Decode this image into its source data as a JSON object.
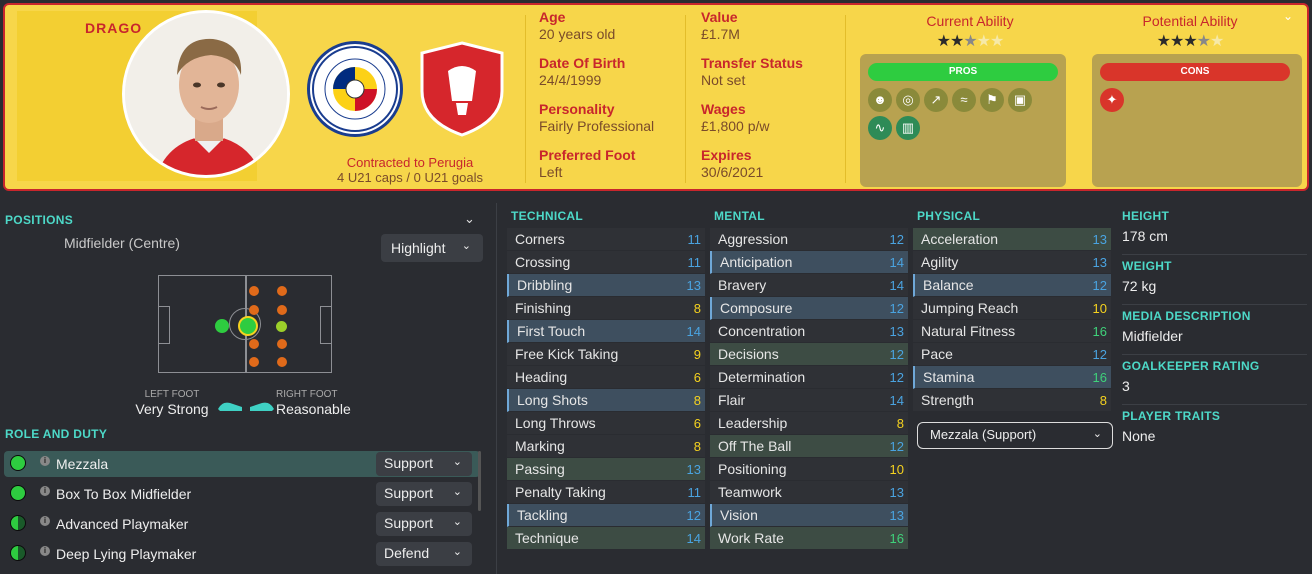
{
  "header": {
    "name": "DRAGO",
    "contract_line": "Contracted to Perugia",
    "caps_line": "4 U21 caps / 0 U21 goals",
    "info_left": [
      {
        "label": "Age",
        "value": "20 years old"
      },
      {
        "label": "Date Of Birth",
        "value": "24/4/1999"
      },
      {
        "label": "Personality",
        "value": "Fairly Professional"
      },
      {
        "label": "Preferred Foot",
        "value": "Left"
      }
    ],
    "info_right": [
      {
        "label": "Value",
        "value": "£1.7M"
      },
      {
        "label": "Transfer Status",
        "value": "Not set"
      },
      {
        "label": "Wages",
        "value": "£1,800 p/w"
      },
      {
        "label": "Expires",
        "value": "30/6/2021"
      }
    ],
    "current_ability": {
      "label": "Current Ability",
      "stars": 2.5
    },
    "potential_ability": {
      "label": "Potential Ability",
      "stars": 3.5
    },
    "pros_label": "PROS",
    "cons_label": "CONS",
    "pros_icons": [
      "brain-icon",
      "target-icon",
      "boot-icon",
      "wings-icon",
      "flag-icon",
      "field-icon",
      "pulse-icon",
      "locker-icon"
    ],
    "cons_icons": [
      "footprint-icon"
    ],
    "colors": {
      "accent": "#c8262c",
      "header_bg": "#f7d64a",
      "pros": "#2ecc40",
      "cons": "#d9352a"
    }
  },
  "positions": {
    "title": "POSITIONS",
    "primary": "Midfielder (Centre)",
    "highlight_label": "Highlight",
    "left_foot_label": "LEFT FOOT",
    "left_foot_value": "Very Strong",
    "right_foot_label": "RIGHT FOOT",
    "right_foot_value": "Reasonable"
  },
  "role_duty": {
    "title": "ROLE AND DUTY",
    "roles": [
      {
        "name": "Mezzala",
        "duty": "Support"
      },
      {
        "name": "Box To Box Midfielder",
        "duty": "Support"
      },
      {
        "name": "Advanced Playmaker",
        "duty": "Support"
      },
      {
        "name": "Deep Lying Playmaker",
        "duty": "Defend"
      }
    ]
  },
  "technical": {
    "title": "TECHNICAL",
    "attrs": [
      {
        "name": "Corners",
        "value": "11"
      },
      {
        "name": "Crossing",
        "value": "11"
      },
      {
        "name": "Dribbling",
        "value": "13"
      },
      {
        "name": "Finishing",
        "value": "8"
      },
      {
        "name": "First Touch",
        "value": "14"
      },
      {
        "name": "Free Kick Taking",
        "value": "9"
      },
      {
        "name": "Heading",
        "value": "6"
      },
      {
        "name": "Long Shots",
        "value": "8"
      },
      {
        "name": "Long Throws",
        "value": "6"
      },
      {
        "name": "Marking",
        "value": "8"
      },
      {
        "name": "Passing",
        "value": "13"
      },
      {
        "name": "Penalty Taking",
        "value": "11"
      },
      {
        "name": "Tackling",
        "value": "12"
      },
      {
        "name": "Technique",
        "value": "14"
      }
    ]
  },
  "mental": {
    "title": "MENTAL",
    "attrs": [
      {
        "name": "Aggression",
        "value": "12"
      },
      {
        "name": "Anticipation",
        "value": "14"
      },
      {
        "name": "Bravery",
        "value": "14"
      },
      {
        "name": "Composure",
        "value": "12"
      },
      {
        "name": "Concentration",
        "value": "13"
      },
      {
        "name": "Decisions",
        "value": "12"
      },
      {
        "name": "Determination",
        "value": "12"
      },
      {
        "name": "Flair",
        "value": "14"
      },
      {
        "name": "Leadership",
        "value": "8"
      },
      {
        "name": "Off The Ball",
        "value": "12"
      },
      {
        "name": "Positioning",
        "value": "10"
      },
      {
        "name": "Teamwork",
        "value": "13"
      },
      {
        "name": "Vision",
        "value": "13"
      },
      {
        "name": "Work Rate",
        "value": "16"
      }
    ]
  },
  "physical": {
    "title": "PHYSICAL",
    "attrs": [
      {
        "name": "Acceleration",
        "value": "13"
      },
      {
        "name": "Agility",
        "value": "13"
      },
      {
        "name": "Balance",
        "value": "12"
      },
      {
        "name": "Jumping Reach",
        "value": "10"
      },
      {
        "name": "Natural Fitness",
        "value": "16"
      },
      {
        "name": "Pace",
        "value": "12"
      },
      {
        "name": "Stamina",
        "value": "16"
      },
      {
        "name": "Strength",
        "value": "8"
      }
    ],
    "role_select": "Mezzala (Support)"
  },
  "info": {
    "height_label": "HEIGHT",
    "height": "178 cm",
    "weight_label": "WEIGHT",
    "weight": "72 kg",
    "media_label": "MEDIA DESCRIPTION",
    "media": "Midfielder",
    "gk_label": "GOALKEEPER RATING",
    "gk": "3",
    "traits_label": "PLAYER TRAITS",
    "traits": "None"
  }
}
